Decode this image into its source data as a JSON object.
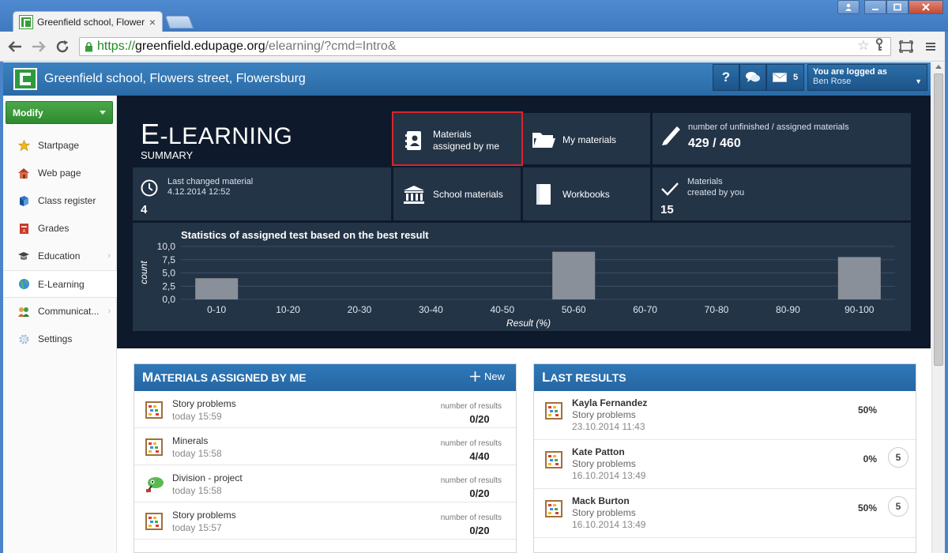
{
  "browser": {
    "tab_title": "Greenfield school, Flowers",
    "url_proto": "https://",
    "url_host": "greenfield.edupage.org",
    "url_path": "/elearning/?cmd=Intro&"
  },
  "header": {
    "school_name": "Greenfield school, Flowers street, Flowersburg",
    "help_label": "?",
    "messages_count": "5",
    "logged_as_label": "You are logged as",
    "user_name": "Ben Rose"
  },
  "sidebar": {
    "modify_label": "Modify",
    "items": [
      {
        "label": "Startpage",
        "icon": "star-icon"
      },
      {
        "label": "Web page",
        "icon": "house-icon"
      },
      {
        "label": "Class register",
        "icon": "book-icon"
      },
      {
        "label": "Grades",
        "icon": "grade-book-icon"
      },
      {
        "label": "Education",
        "icon": "education-icon"
      },
      {
        "label": "E-Learning",
        "icon": "globe-icon"
      },
      {
        "label": "Communicat...",
        "icon": "communication-icon"
      },
      {
        "label": "Settings",
        "icon": "gear-icon"
      }
    ]
  },
  "dashboard": {
    "title_big_first": "E",
    "title_big_rest": "-LEARNING",
    "title_small": "SUMMARY",
    "tiles": {
      "assigned_line1": "Materials",
      "assigned_line2": "assigned by me",
      "my_materials": "My materials",
      "unfinished_label": "number of unfinished / assigned materials",
      "unfinished_value": "429 / 460",
      "last_changed_label": "Last changed material",
      "last_changed_date": "4.12.2014 12:52",
      "last_changed_value": "4",
      "school_materials": "School materials",
      "workbooks": "Workbooks",
      "created_line1": "Materials",
      "created_line2": "created by you",
      "created_value": "15"
    }
  },
  "chart_data": {
    "type": "bar",
    "title": "Statistics of assigned test based on the best result",
    "xlabel": "Result (%)",
    "ylabel": "count",
    "categories": [
      "0-10",
      "10-20",
      "20-30",
      "30-40",
      "40-50",
      "50-60",
      "60-70",
      "70-80",
      "80-90",
      "90-100"
    ],
    "values": [
      4,
      0,
      0,
      0,
      0,
      9,
      0,
      0,
      0,
      8
    ],
    "ylim": [
      0,
      10
    ],
    "yticks": [
      "0,0",
      "2,5",
      "5,0",
      "7,5",
      "10,0"
    ],
    "grid": true,
    "bar_color": "#8a9099"
  },
  "materials_panel": {
    "title_first": "M",
    "title_rest": "ATERIALS ASSIGNED BY ME",
    "new_label": "New",
    "results_label": "number of results",
    "rows": [
      {
        "name": "Story problems",
        "time": "today 15:59",
        "count": "0/20",
        "icon": "abacus-icon"
      },
      {
        "name": "Minerals",
        "time": "today 15:58",
        "count": "4/40",
        "icon": "abacus-icon"
      },
      {
        "name": "Division - project",
        "time": "today 15:58",
        "count": "0/20",
        "icon": "project-icon"
      },
      {
        "name": "Story problems",
        "time": "today 15:57",
        "count": "0/20",
        "icon": "abacus-icon"
      }
    ]
  },
  "results_panel": {
    "title_first": "L",
    "title_rest": "AST RESULTS",
    "rows": [
      {
        "name": "Kayla Fernandez",
        "subject": "Story problems",
        "date": "23.10.2014 11:43",
        "percent": "50%",
        "grade": ""
      },
      {
        "name": "Kate Patton",
        "subject": "Story problems",
        "date": "16.10.2014 13:49",
        "percent": "0%",
        "grade": "5"
      },
      {
        "name": "Mack Burton",
        "subject": "Story problems",
        "date": "16.10.2014 13:49",
        "percent": "50%",
        "grade": "5"
      }
    ]
  },
  "colors": {
    "dashboard_bg": "#0e1a2b",
    "tile_bg": "#243447",
    "accent_blue": "#2f78b8",
    "modify_green": "#3a9b3a",
    "highlight_red": "#d7262b"
  }
}
